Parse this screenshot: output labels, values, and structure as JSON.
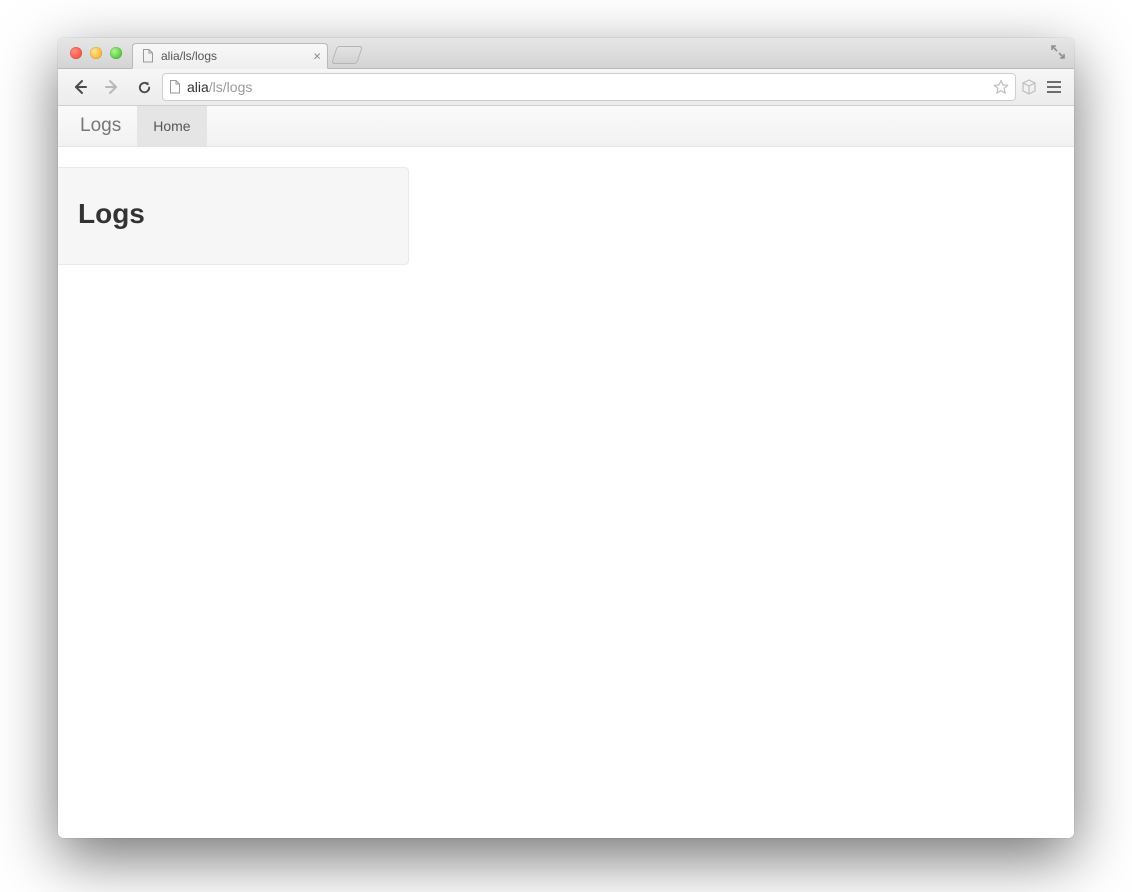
{
  "browser": {
    "tab_title": "alia/ls/logs",
    "url_host": "alia",
    "url_path": "/ls/logs"
  },
  "navbar": {
    "brand": "Logs",
    "items": [
      {
        "label": "Home",
        "active": true
      }
    ]
  },
  "card": {
    "title": "Logs"
  }
}
